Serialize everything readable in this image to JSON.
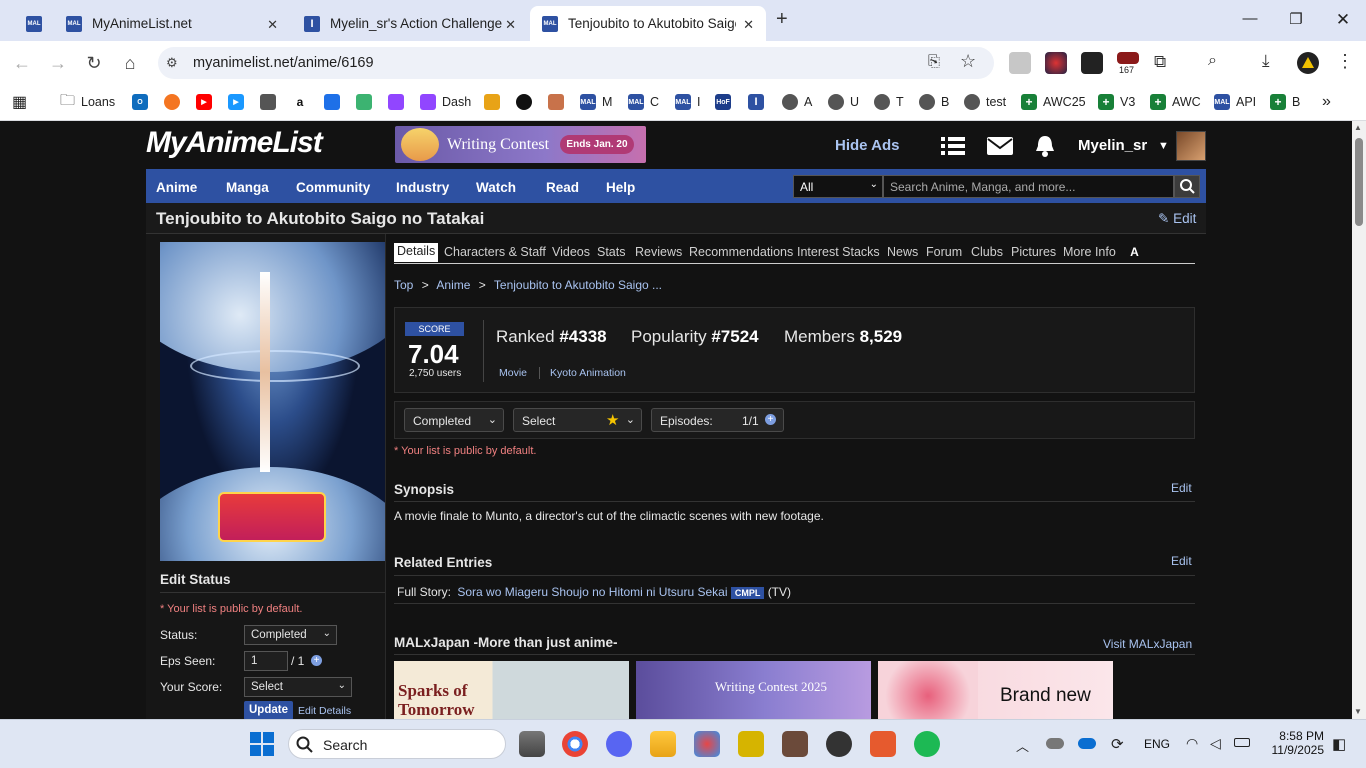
{
  "browser": {
    "tabs": [
      {
        "label": "",
        "favicon": "MAL"
      },
      {
        "label": "MyAnimeList.net",
        "favicon": "MAL"
      },
      {
        "label": "Myelin_sr's Action Challenge",
        "favicon": "I"
      },
      {
        "label": "Tenjoubito to Akutobito Saigo n",
        "favicon": "MAL"
      }
    ],
    "url": "myanimelist.net/anime/6169",
    "extension_badge": "167",
    "bookmarks": [
      "Loans",
      "Dash",
      "M",
      "C",
      "I",
      "A",
      "U",
      "T",
      "B",
      "test",
      "AWC25",
      "V3",
      "AWC",
      "API",
      "B"
    ]
  },
  "header": {
    "logo": "MyAnimeList",
    "banner_text": "Writing Contest",
    "banner_badge": "Ends Jan. 20",
    "hide_ads": "Hide Ads",
    "username": "Myelin_sr"
  },
  "menu": {
    "items": [
      "Anime",
      "Manga",
      "Community",
      "Industry",
      "Watch",
      "Read",
      "Help"
    ],
    "search_category": "All",
    "search_placeholder": "Search Anime, Manga, and more..."
  },
  "anime": {
    "title": "Tenjoubito to Akutobito Saigo no Tatakai",
    "edit": "Edit"
  },
  "page_tabs": [
    "Details",
    "Characters & Staff",
    "Videos",
    "Stats",
    "Reviews",
    "Recommendations",
    "Interest Stacks",
    "News",
    "Forum",
    "Clubs",
    "Pictures",
    "More Info"
  ],
  "breadcrumb": [
    "Top",
    ">",
    "Anime",
    ">",
    "Tenjoubito to Akutobito Saigo ..."
  ],
  "score": {
    "label": "SCORE",
    "value": "7.04",
    "users": "2,750 users",
    "ranked_label": "Ranked",
    "ranked": "#4338",
    "popularity_label": "Popularity",
    "popularity": "#7524",
    "members_label": "Members",
    "members": "8,529",
    "type": "Movie",
    "studio": "Kyoto Animation"
  },
  "actions": {
    "status": "Completed",
    "score_select": "Select",
    "episodes_label": "Episodes:",
    "episodes_value": "1/1",
    "public_note": "* Your list is public by default."
  },
  "synopsis": {
    "heading": "Synopsis",
    "edit": "Edit",
    "text": "A movie finale to Munto, a director's cut of the climactic scenes with new footage."
  },
  "related": {
    "heading": "Related Entries",
    "edit": "Edit",
    "type": "Full Story:",
    "title": "Sora wo Miageru Shoujo no Hitomi ni Utsuru Sekai",
    "badge": "CMPL",
    "format": "(TV)"
  },
  "malxjapan": {
    "heading": "MALxJapan -More than just anime-",
    "link": "Visit MALxJapan",
    "items": [
      "Sparks of Tomorrow",
      "Writing Contest 2025",
      "Brand new"
    ]
  },
  "edit_status": {
    "heading": "Edit Status",
    "public_note": "* Your list is public by default.",
    "status_label": "Status:",
    "status_value": "Completed",
    "eps_label": "Eps Seen:",
    "eps_value": "1",
    "eps_total": "/ 1",
    "score_label": "Your Score:",
    "score_value": "Select",
    "update": "Update",
    "edit_details": "Edit Details"
  },
  "taskbar": {
    "search": "Search",
    "lang": "ENG",
    "time": "8:58 PM",
    "date": "11/9/2025"
  }
}
